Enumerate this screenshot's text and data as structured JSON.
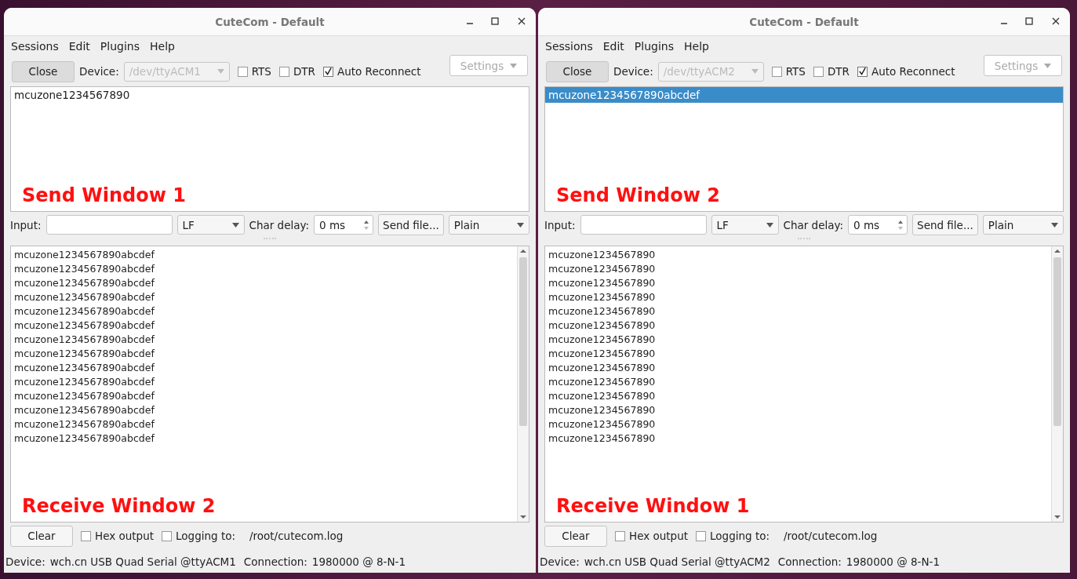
{
  "windows": [
    {
      "title": "CuteCom - Default",
      "menu": [
        "Sessions",
        "Edit",
        "Plugins",
        "Help"
      ],
      "toolbar": {
        "close_button": "Close",
        "device_label": "Device:",
        "device_value": "/dev/ttyACM1",
        "checkboxes": [
          {
            "label": "RTS",
            "checked": false
          },
          {
            "label": "DTR",
            "checked": false
          },
          {
            "label": "Auto Reconnect",
            "checked": true
          }
        ],
        "settings_button": "Settings"
      },
      "send_history": {
        "items": [
          {
            "text": "mcuzone1234567890",
            "selected": false
          }
        ],
        "annotation": "Send Window 1"
      },
      "input_bar": {
        "input_label": "Input:",
        "line_ending": "LF",
        "char_delay_label": "Char delay:",
        "char_delay_value": "0 ms",
        "send_file_button": "Send file...",
        "format": "Plain"
      },
      "receive": {
        "lines": [
          "mcuzone1234567890abcdef",
          "mcuzone1234567890abcdef",
          "mcuzone1234567890abcdef",
          "mcuzone1234567890abcdef",
          "mcuzone1234567890abcdef",
          "mcuzone1234567890abcdef",
          "mcuzone1234567890abcdef",
          "mcuzone1234567890abcdef",
          "mcuzone1234567890abcdef",
          "mcuzone1234567890abcdef",
          "mcuzone1234567890abcdef",
          "mcuzone1234567890abcdef",
          "mcuzone1234567890abcdef",
          "mcuzone1234567890abcdef"
        ],
        "annotation": "Receive Window 2"
      },
      "bottom": {
        "clear_button": "Clear",
        "checkboxes": [
          {
            "label": "Hex output",
            "checked": false
          },
          {
            "label": "Logging to:",
            "checked": false
          }
        ],
        "log_path": "/root/cutecom.log"
      },
      "status_bar": {
        "device_label": "Device:",
        "device_value": "wch.cn USB Quad Serial @ttyACM1",
        "connection_label": "Connection:",
        "connection_value": "1980000 @ 8-N-1"
      }
    },
    {
      "title": "CuteCom - Default",
      "menu": [
        "Sessions",
        "Edit",
        "Plugins",
        "Help"
      ],
      "toolbar": {
        "close_button": "Close",
        "device_label": "Device:",
        "device_value": "/dev/ttyACM2",
        "checkboxes": [
          {
            "label": "RTS",
            "checked": false
          },
          {
            "label": "DTR",
            "checked": false
          },
          {
            "label": "Auto Reconnect",
            "checked": true
          }
        ],
        "settings_button": "Settings"
      },
      "send_history": {
        "items": [
          {
            "text": "mcuzone1234567890abcdef",
            "selected": true
          }
        ],
        "annotation": "Send Window 2"
      },
      "input_bar": {
        "input_label": "Input:",
        "line_ending": "LF",
        "char_delay_label": "Char delay:",
        "char_delay_value": "0 ms",
        "send_file_button": "Send file...",
        "format": "Plain"
      },
      "receive": {
        "lines": [
          "mcuzone1234567890",
          "mcuzone1234567890",
          "mcuzone1234567890",
          "mcuzone1234567890",
          "mcuzone1234567890",
          "mcuzone1234567890",
          "mcuzone1234567890",
          "mcuzone1234567890",
          "mcuzone1234567890",
          "mcuzone1234567890",
          "mcuzone1234567890",
          "mcuzone1234567890",
          "mcuzone1234567890",
          "mcuzone1234567890"
        ],
        "annotation": "Receive Window 1"
      },
      "bottom": {
        "clear_button": "Clear",
        "checkboxes": [
          {
            "label": "Hex output",
            "checked": false
          },
          {
            "label": "Logging to:",
            "checked": false
          }
        ],
        "log_path": "/root/cutecom.log"
      },
      "status_bar": {
        "device_label": "Device:",
        "device_value": "wch.cn USB Quad Serial @ttyACM2",
        "connection_label": "Connection:",
        "connection_value": "1980000 @ 8-N-1"
      }
    }
  ]
}
